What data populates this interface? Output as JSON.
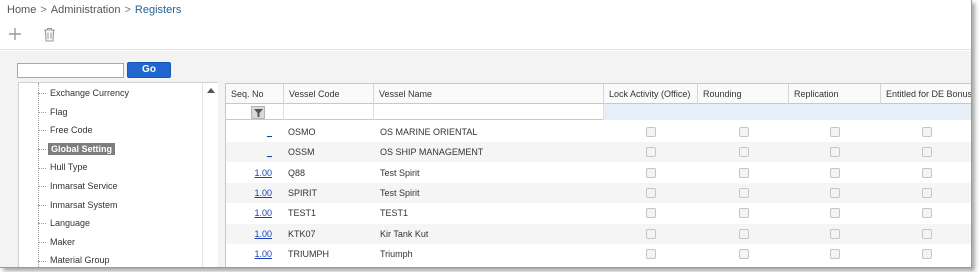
{
  "breadcrumb": {
    "home": "Home",
    "sep": ">",
    "admin": "Administration",
    "current": "Registers"
  },
  "toolbar": {
    "add_icon": "plus-icon",
    "delete_icon": "trash-icon"
  },
  "search": {
    "value": "",
    "go_label": "Go"
  },
  "tree": {
    "items": [
      {
        "label": "Exchange Currency",
        "selected": false
      },
      {
        "label": "Flag",
        "selected": false
      },
      {
        "label": "Free Code",
        "selected": false
      },
      {
        "label": "Global Setting",
        "selected": true
      },
      {
        "label": "Hull Type",
        "selected": false
      },
      {
        "label": "Inmarsat Service",
        "selected": false
      },
      {
        "label": "Inmarsat System",
        "selected": false
      },
      {
        "label": "Language",
        "selected": false
      },
      {
        "label": "Maker",
        "selected": false
      },
      {
        "label": "Material Group",
        "selected": false
      }
    ]
  },
  "grid": {
    "columns": [
      "Seq. No",
      "Vessel Code",
      "Vessel Name",
      "Lock Activity (Office)",
      "Rounding",
      "Replication",
      "Entitled for DE Bonus"
    ],
    "rows": [
      {
        "seq": "_",
        "code": "OSMO",
        "name": "OS MARINE ORIENTAL"
      },
      {
        "seq": "_",
        "code": "OSSM",
        "name": "OS SHIP MANAGEMENT"
      },
      {
        "seq": "1.00",
        "code": "Q88",
        "name": "Test Spirit"
      },
      {
        "seq": "1.00",
        "code": "SPIRIT",
        "name": "Test Spirit"
      },
      {
        "seq": "1.00",
        "code": "TEST1",
        "name": "TEST1"
      },
      {
        "seq": "1.00",
        "code": "KTK07",
        "name": "Kir Tank Kut"
      },
      {
        "seq": "1.00",
        "code": "TRIUMPH",
        "name": "Triumph"
      }
    ]
  },
  "colors": {
    "accent": "#1f66d1",
    "link": "#1a3fb8",
    "filter_bg": "#e6eef7",
    "selected_bg": "#7d7d7d"
  }
}
